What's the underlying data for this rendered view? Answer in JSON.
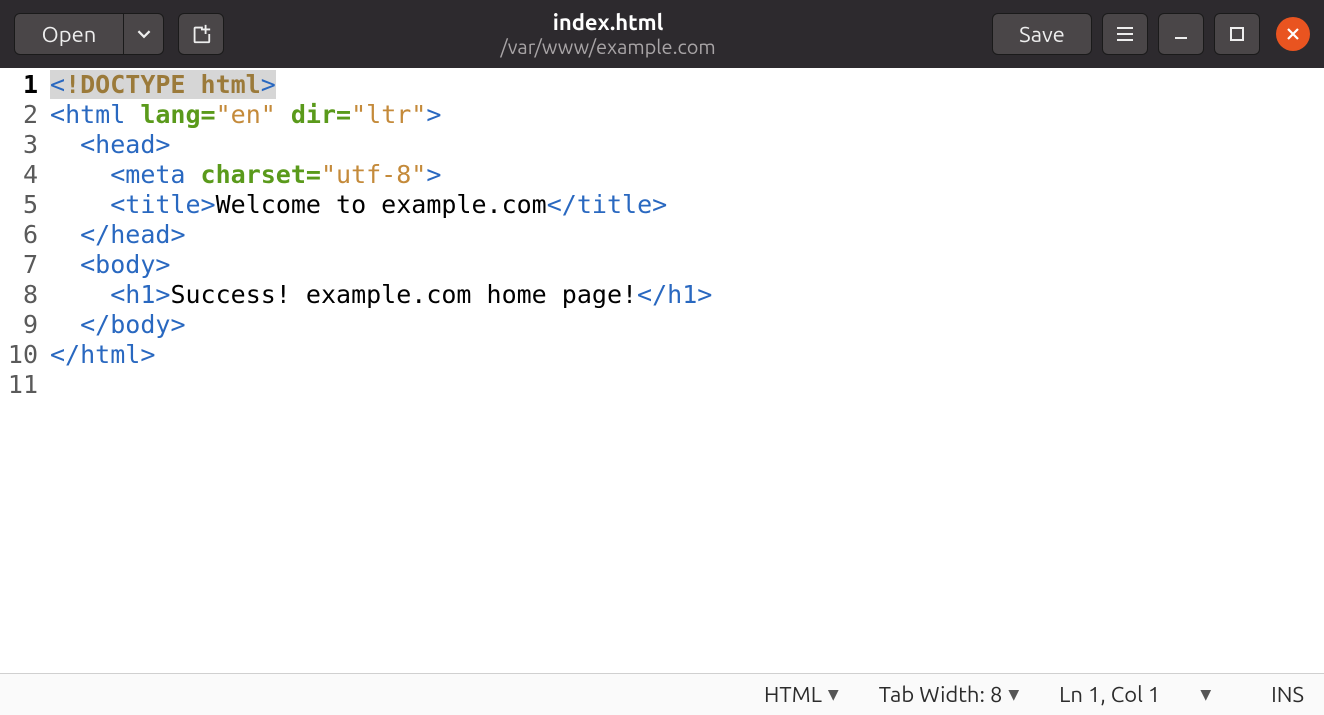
{
  "titlebar": {
    "open_label": "Open",
    "filename": "index.html",
    "filepath": "/var/www/example.com",
    "save_label": "Save"
  },
  "code": {
    "lines": [
      {
        "n": 1,
        "tokens": [
          {
            "t": "<",
            "c": "hl-bg tag-br"
          },
          {
            "t": "!DOCTYPE html",
            "c": "hl-bg doctype"
          },
          {
            "t": ">",
            "c": "hl-bg tag-br"
          }
        ]
      },
      {
        "n": 2,
        "tokens": [
          {
            "t": "<",
            "c": "tag-br"
          },
          {
            "t": "html ",
            "c": "tag-name"
          },
          {
            "t": "lang=",
            "c": "attr"
          },
          {
            "t": "\"en\"",
            "c": "str"
          },
          {
            "t": " ",
            "c": "txt"
          },
          {
            "t": "dir=",
            "c": "attr"
          },
          {
            "t": "\"ltr\"",
            "c": "str"
          },
          {
            "t": ">",
            "c": "tag-br"
          }
        ]
      },
      {
        "n": 3,
        "tokens": [
          {
            "t": "  ",
            "c": "txt"
          },
          {
            "t": "<",
            "c": "tag-br"
          },
          {
            "t": "head",
            "c": "tag-name"
          },
          {
            "t": ">",
            "c": "tag-br"
          }
        ]
      },
      {
        "n": 4,
        "tokens": [
          {
            "t": "    ",
            "c": "txt"
          },
          {
            "t": "<",
            "c": "tag-br"
          },
          {
            "t": "meta ",
            "c": "tag-name"
          },
          {
            "t": "charset=",
            "c": "attr"
          },
          {
            "t": "\"utf-8\"",
            "c": "str"
          },
          {
            "t": ">",
            "c": "tag-br"
          }
        ]
      },
      {
        "n": 5,
        "tokens": [
          {
            "t": "    ",
            "c": "txt"
          },
          {
            "t": "<",
            "c": "tag-br"
          },
          {
            "t": "title",
            "c": "tag-name"
          },
          {
            "t": ">",
            "c": "tag-br"
          },
          {
            "t": "Welcome to example.com",
            "c": "txt"
          },
          {
            "t": "</",
            "c": "tag-br"
          },
          {
            "t": "title",
            "c": "tag-name"
          },
          {
            "t": ">",
            "c": "tag-br"
          }
        ]
      },
      {
        "n": 6,
        "tokens": [
          {
            "t": "  ",
            "c": "txt"
          },
          {
            "t": "</",
            "c": "tag-br"
          },
          {
            "t": "head",
            "c": "tag-name"
          },
          {
            "t": ">",
            "c": "tag-br"
          }
        ]
      },
      {
        "n": 7,
        "tokens": [
          {
            "t": "  ",
            "c": "txt"
          },
          {
            "t": "<",
            "c": "tag-br"
          },
          {
            "t": "body",
            "c": "tag-name"
          },
          {
            "t": ">",
            "c": "tag-br"
          }
        ]
      },
      {
        "n": 8,
        "tokens": [
          {
            "t": "    ",
            "c": "txt"
          },
          {
            "t": "<",
            "c": "tag-br"
          },
          {
            "t": "h1",
            "c": "tag-name"
          },
          {
            "t": ">",
            "c": "tag-br"
          },
          {
            "t": "Success! example.com home page!",
            "c": "txt"
          },
          {
            "t": "</",
            "c": "tag-br"
          },
          {
            "t": "h1",
            "c": "tag-name"
          },
          {
            "t": ">",
            "c": "tag-br"
          }
        ]
      },
      {
        "n": 9,
        "tokens": [
          {
            "t": "  ",
            "c": "txt"
          },
          {
            "t": "</",
            "c": "tag-br"
          },
          {
            "t": "body",
            "c": "tag-name"
          },
          {
            "t": ">",
            "c": "tag-br"
          }
        ]
      },
      {
        "n": 10,
        "tokens": [
          {
            "t": "</",
            "c": "tag-br"
          },
          {
            "t": "html",
            "c": "tag-name"
          },
          {
            "t": ">",
            "c": "tag-br"
          }
        ]
      },
      {
        "n": 11,
        "tokens": []
      }
    ],
    "current_line": 1
  },
  "statusbar": {
    "language": "HTML",
    "tab_width": "Tab Width: 8",
    "cursor": "Ln 1, Col 1",
    "insert_mode": "INS"
  }
}
